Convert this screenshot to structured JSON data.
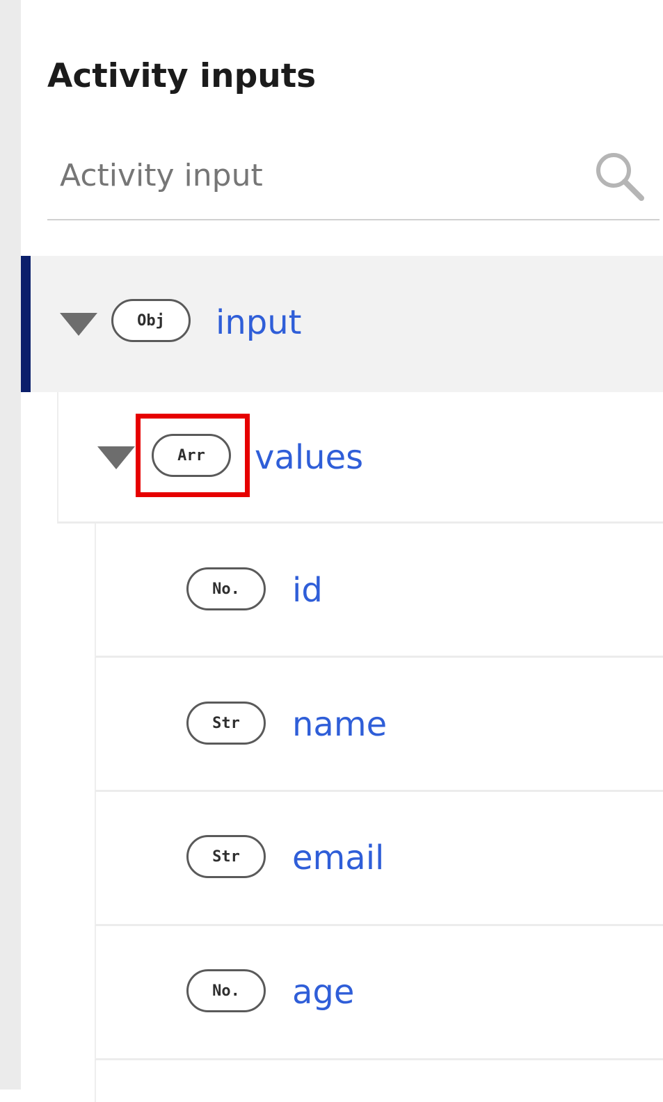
{
  "panel": {
    "title": "Activity inputs"
  },
  "search": {
    "placeholder": "Activity input",
    "value": "",
    "icon": "search-icon"
  },
  "tree": {
    "root": {
      "type_badge": "Obj",
      "label": "input",
      "expanded": true,
      "selected": true
    },
    "values": {
      "type_badge": "Arr",
      "label": "values",
      "expanded": true,
      "highlighted": true
    },
    "fields": [
      {
        "type_badge": "No.",
        "label": "id"
      },
      {
        "type_badge": "Str",
        "label": "name"
      },
      {
        "type_badge": "Str",
        "label": "email"
      },
      {
        "type_badge": "No.",
        "label": "age"
      }
    ]
  },
  "colors": {
    "selection_bar": "#0b1f6b",
    "link_text": "#2f5ed8",
    "highlight_box": "#e60000",
    "selected_row_bg": "#f2f2f2"
  }
}
